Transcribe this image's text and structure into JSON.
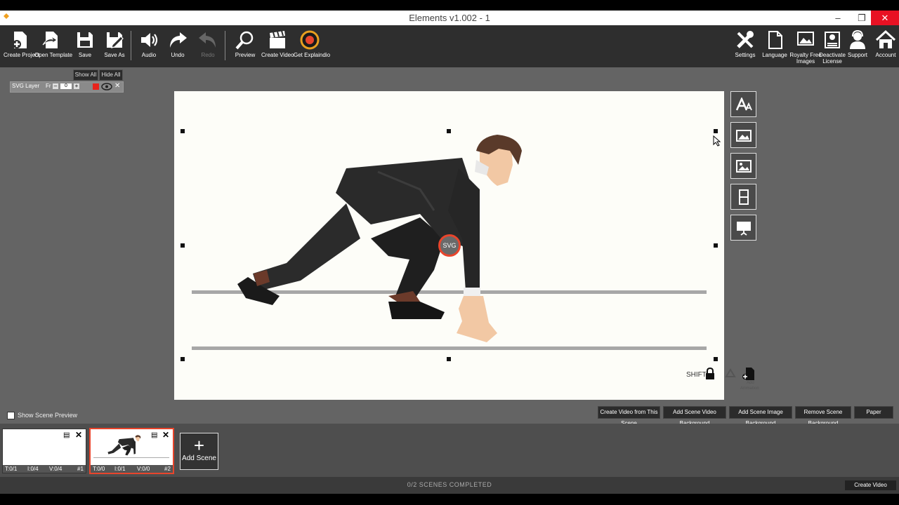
{
  "window": {
    "title": "Elements v1.002 - 1"
  },
  "toolbar": {
    "create_project": "Create Project",
    "open_template": "Open Template",
    "save": "Save",
    "save_as": "Save As",
    "audio": "Audio",
    "undo": "Undo",
    "redo": "Redo",
    "preview": "Preview",
    "create_video": "Create Video",
    "get_explaindio": "Get Explaindio",
    "settings": "Settings",
    "language": "Language",
    "royalty_free_line1": "Royalty Free",
    "royalty_free_line2": "Images",
    "deactivate_line1": "Deactivate",
    "deactivate_line2": "License",
    "support": "Support",
    "account": "Account"
  },
  "layers": {
    "show_all": "Show All",
    "hide_all": "Hide All",
    "layer_name": "SVG Layer",
    "fr_label": "Fr",
    "fr_value": "0"
  },
  "canvas": {
    "svg_badge": "SVG",
    "shift_label": "SHIFT",
    "add_animation_line1": "Add",
    "add_animation_line2": "Animation"
  },
  "scene_controls": {
    "show_scene_preview": "Show Scene Preview",
    "create_from_scene": "Create Video from This Scene",
    "add_video_bg": "Add Scene Video Background",
    "add_image_bg": "Add Scene Image Background",
    "remove_bg": "Remove Scene Background",
    "paper": "Paper"
  },
  "timeline": {
    "scenes": [
      {
        "t": "T:0/1",
        "i": "I:0/4",
        "v": "V:0/4",
        "n": "#1"
      },
      {
        "t": "T:0/0",
        "i": "I:0/1",
        "v": "V:0/0",
        "n": "#2"
      }
    ],
    "add_scene": "Add Scene"
  },
  "status": {
    "completed": "0/2 SCENES COMPLETED",
    "create_video": "Create Video"
  },
  "colors": {
    "accent_red": "#e8452c",
    "toolbar_bg": "#2e2e2e",
    "workspace_bg": "#646464"
  }
}
